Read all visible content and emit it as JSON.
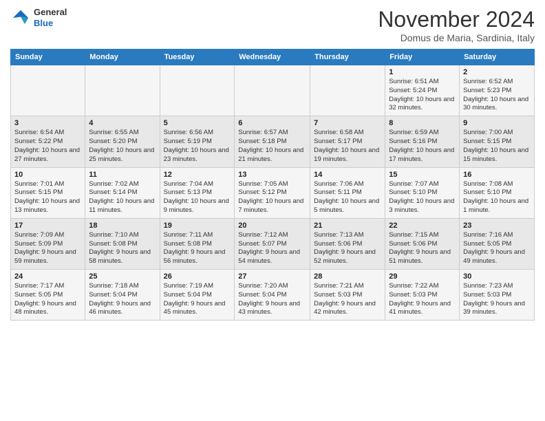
{
  "logo": {
    "general": "General",
    "blue": "Blue"
  },
  "header": {
    "month": "November 2024",
    "location": "Domus de Maria, Sardinia, Italy"
  },
  "weekdays": [
    "Sunday",
    "Monday",
    "Tuesday",
    "Wednesday",
    "Thursday",
    "Friday",
    "Saturday"
  ],
  "weeks": [
    [
      {
        "day": "",
        "info": ""
      },
      {
        "day": "",
        "info": ""
      },
      {
        "day": "",
        "info": ""
      },
      {
        "day": "",
        "info": ""
      },
      {
        "day": "",
        "info": ""
      },
      {
        "day": "1",
        "info": "Sunrise: 6:51 AM\nSunset: 5:24 PM\nDaylight: 10 hours and 32 minutes."
      },
      {
        "day": "2",
        "info": "Sunrise: 6:52 AM\nSunset: 5:23 PM\nDaylight: 10 hours and 30 minutes."
      }
    ],
    [
      {
        "day": "3",
        "info": "Sunrise: 6:54 AM\nSunset: 5:22 PM\nDaylight: 10 hours and 27 minutes."
      },
      {
        "day": "4",
        "info": "Sunrise: 6:55 AM\nSunset: 5:20 PM\nDaylight: 10 hours and 25 minutes."
      },
      {
        "day": "5",
        "info": "Sunrise: 6:56 AM\nSunset: 5:19 PM\nDaylight: 10 hours and 23 minutes."
      },
      {
        "day": "6",
        "info": "Sunrise: 6:57 AM\nSunset: 5:18 PM\nDaylight: 10 hours and 21 minutes."
      },
      {
        "day": "7",
        "info": "Sunrise: 6:58 AM\nSunset: 5:17 PM\nDaylight: 10 hours and 19 minutes."
      },
      {
        "day": "8",
        "info": "Sunrise: 6:59 AM\nSunset: 5:16 PM\nDaylight: 10 hours and 17 minutes."
      },
      {
        "day": "9",
        "info": "Sunrise: 7:00 AM\nSunset: 5:15 PM\nDaylight: 10 hours and 15 minutes."
      }
    ],
    [
      {
        "day": "10",
        "info": "Sunrise: 7:01 AM\nSunset: 5:15 PM\nDaylight: 10 hours and 13 minutes."
      },
      {
        "day": "11",
        "info": "Sunrise: 7:02 AM\nSunset: 5:14 PM\nDaylight: 10 hours and 11 minutes."
      },
      {
        "day": "12",
        "info": "Sunrise: 7:04 AM\nSunset: 5:13 PM\nDaylight: 10 hours and 9 minutes."
      },
      {
        "day": "13",
        "info": "Sunrise: 7:05 AM\nSunset: 5:12 PM\nDaylight: 10 hours and 7 minutes."
      },
      {
        "day": "14",
        "info": "Sunrise: 7:06 AM\nSunset: 5:11 PM\nDaylight: 10 hours and 5 minutes."
      },
      {
        "day": "15",
        "info": "Sunrise: 7:07 AM\nSunset: 5:10 PM\nDaylight: 10 hours and 3 minutes."
      },
      {
        "day": "16",
        "info": "Sunrise: 7:08 AM\nSunset: 5:10 PM\nDaylight: 10 hours and 1 minute."
      }
    ],
    [
      {
        "day": "17",
        "info": "Sunrise: 7:09 AM\nSunset: 5:09 PM\nDaylight: 9 hours and 59 minutes."
      },
      {
        "day": "18",
        "info": "Sunrise: 7:10 AM\nSunset: 5:08 PM\nDaylight: 9 hours and 58 minutes."
      },
      {
        "day": "19",
        "info": "Sunrise: 7:11 AM\nSunset: 5:08 PM\nDaylight: 9 hours and 56 minutes."
      },
      {
        "day": "20",
        "info": "Sunrise: 7:12 AM\nSunset: 5:07 PM\nDaylight: 9 hours and 54 minutes."
      },
      {
        "day": "21",
        "info": "Sunrise: 7:13 AM\nSunset: 5:06 PM\nDaylight: 9 hours and 52 minutes."
      },
      {
        "day": "22",
        "info": "Sunrise: 7:15 AM\nSunset: 5:06 PM\nDaylight: 9 hours and 51 minutes."
      },
      {
        "day": "23",
        "info": "Sunrise: 7:16 AM\nSunset: 5:05 PM\nDaylight: 9 hours and 49 minutes."
      }
    ],
    [
      {
        "day": "24",
        "info": "Sunrise: 7:17 AM\nSunset: 5:05 PM\nDaylight: 9 hours and 48 minutes."
      },
      {
        "day": "25",
        "info": "Sunrise: 7:18 AM\nSunset: 5:04 PM\nDaylight: 9 hours and 46 minutes."
      },
      {
        "day": "26",
        "info": "Sunrise: 7:19 AM\nSunset: 5:04 PM\nDaylight: 9 hours and 45 minutes."
      },
      {
        "day": "27",
        "info": "Sunrise: 7:20 AM\nSunset: 5:04 PM\nDaylight: 9 hours and 43 minutes."
      },
      {
        "day": "28",
        "info": "Sunrise: 7:21 AM\nSunset: 5:03 PM\nDaylight: 9 hours and 42 minutes."
      },
      {
        "day": "29",
        "info": "Sunrise: 7:22 AM\nSunset: 5:03 PM\nDaylight: 9 hours and 41 minutes."
      },
      {
        "day": "30",
        "info": "Sunrise: 7:23 AM\nSunset: 5:03 PM\nDaylight: 9 hours and 39 minutes."
      }
    ]
  ]
}
